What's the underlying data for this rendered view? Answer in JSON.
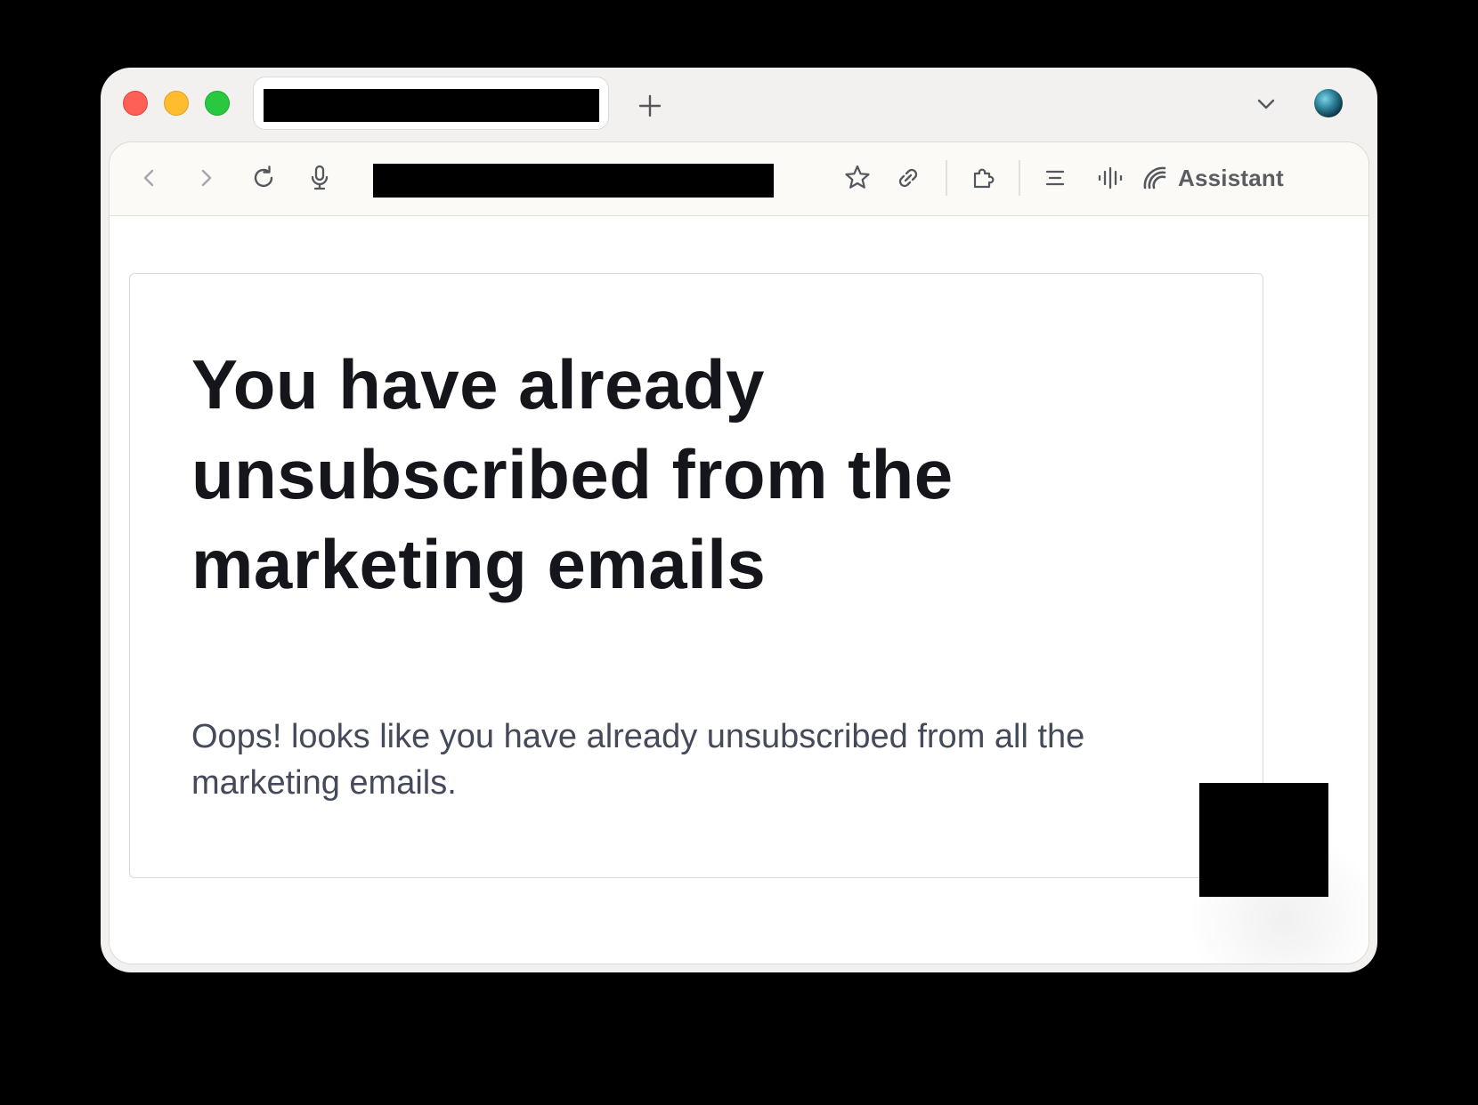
{
  "browser": {
    "toolbar": {
      "assistant_label": "Assistant"
    }
  },
  "page": {
    "heading": "You have already unsubscribed from the marketing emails",
    "message": "Oops! looks like you have already unsubscribed from all the marketing emails."
  },
  "colors": {
    "close": "#fe5f57",
    "minimize": "#febc2e",
    "zoom": "#28c840",
    "heading_text": "#14161c",
    "body_text": "#454a5a"
  }
}
